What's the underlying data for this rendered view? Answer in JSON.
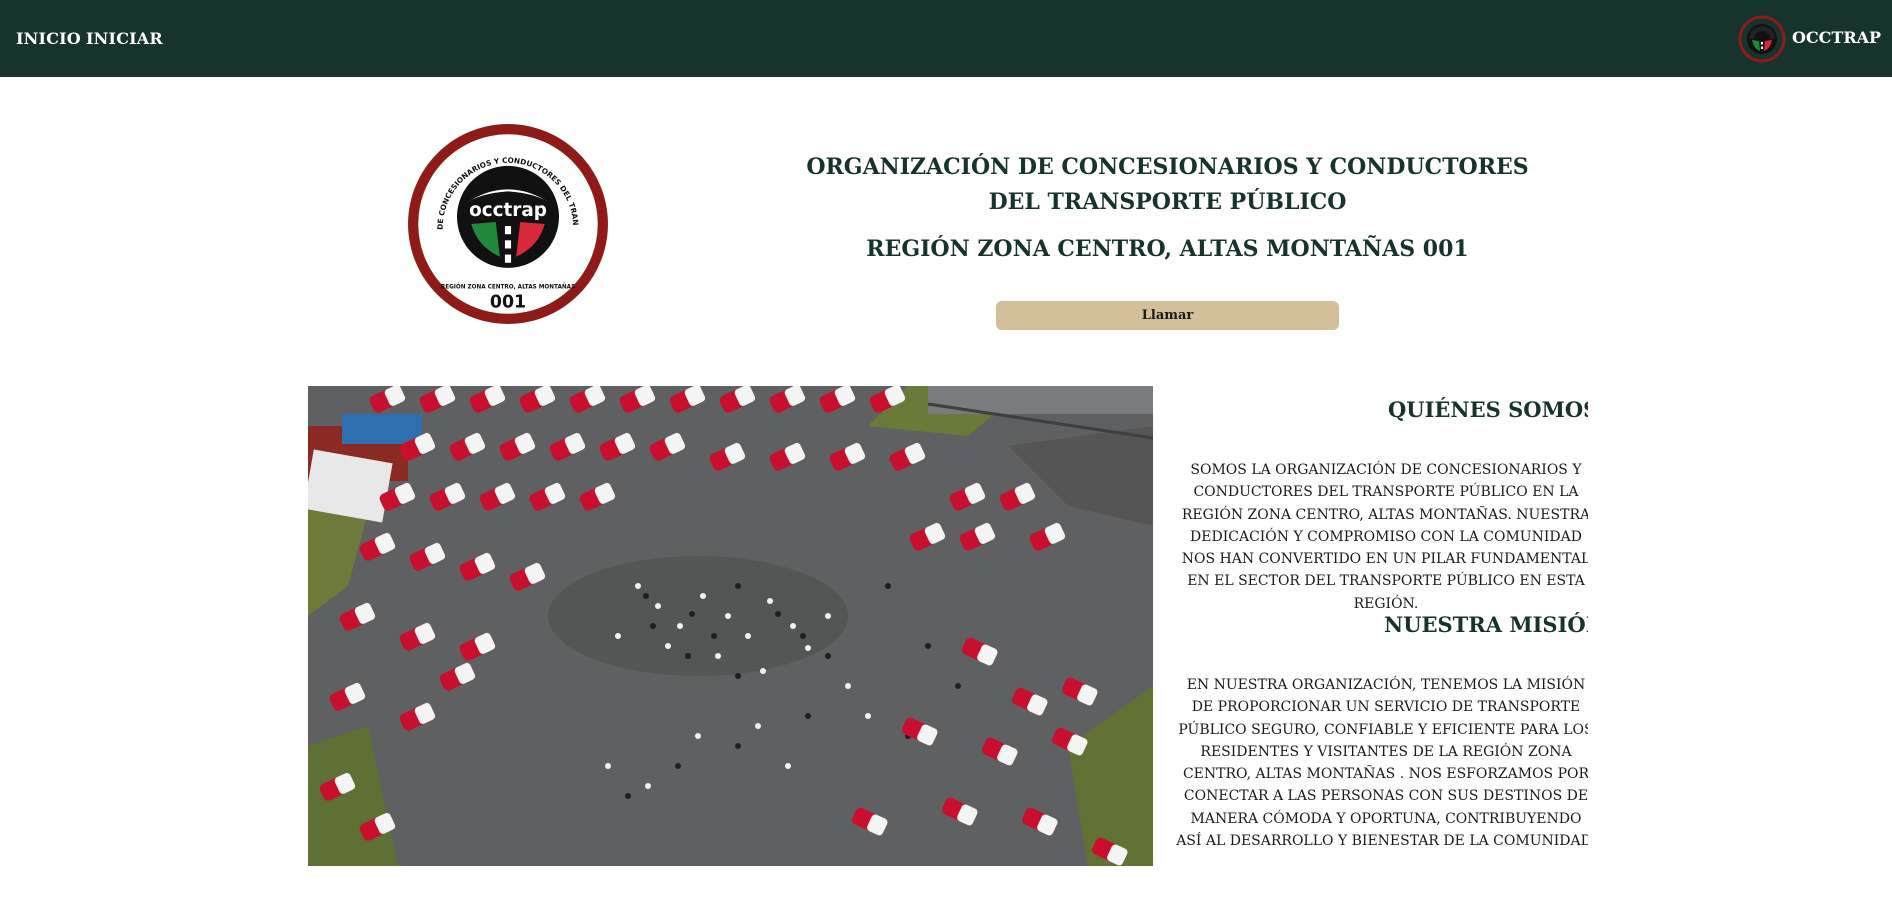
{
  "nav": {
    "links": [
      "INICIO",
      "INICIAR"
    ],
    "brand": "OCCTRAP"
  },
  "logo": {
    "top_text": "ORGANIZACIÓN DE CONCESIONARIOS Y CONDUCTORES DEL TRANSPORTE PÚBLICO",
    "wordmark": "occtrap",
    "bottom_text": "REGIÓN ZONA CENTRO, ALTAS MONTAÑAS",
    "number": "001"
  },
  "hero": {
    "title": "ORGANIZACIÓN DE CONCESIONARIOS Y CONDUCTORES DEL TRANSPORTE PÚBLICO",
    "region": "REGIÓN ZONA CENTRO, ALTAS MONTAÑAS 001",
    "call_label": "Llamar"
  },
  "about": {
    "heading": "QUIÉNES SOMOS?",
    "text": "SOMOS LA ORGANIZACIÓN DE CONCESIONARIOS Y CONDUCTORES DEL TRANSPORTE PÚBLICO EN LA REGIÓN ZONA CENTRO, ALTAS MONTAÑAS. NUESTRA DEDICACIÓN Y COMPROMISO CON LA COMUNIDAD NOS HAN CONVERTIDO EN UN PILAR FUNDAMENTAL EN EL SECTOR DEL TRANSPORTE PÚBLICO EN ESTA REGIÓN."
  },
  "mission": {
    "heading": "NUESTRA MISIÓN",
    "text": "EN NUESTRA ORGANIZACIÓN, TENEMOS LA MISIÓN DE PROPORCIONAR UN SERVICIO DE TRANSPORTE PÚBLICO SEGURO, CONFIABLE Y EFICIENTE PARA LOS RESIDENTES Y VISITANTES DE LA REGIÓN ZONA CENTRO, ALTAS MONTAÑAS . NOS ESFORZAMOS POR CONECTAR A LAS PERSONAS CON SUS DESTINOS DE MANERA CÓMODA Y OPORTUNA, CONTRIBUYENDO ASÍ AL DESARROLLO Y BIENESTAR DE LA COMUNIDAD."
  },
  "colors": {
    "nav_bg": "#17332d",
    "accent_button": "#d3c09a",
    "logo_ring": "#8e1b18",
    "logo_green": "#1f8a3b",
    "logo_red": "#d9283a"
  },
  "icons": {
    "brand": "steering-wheel-logo-icon"
  }
}
